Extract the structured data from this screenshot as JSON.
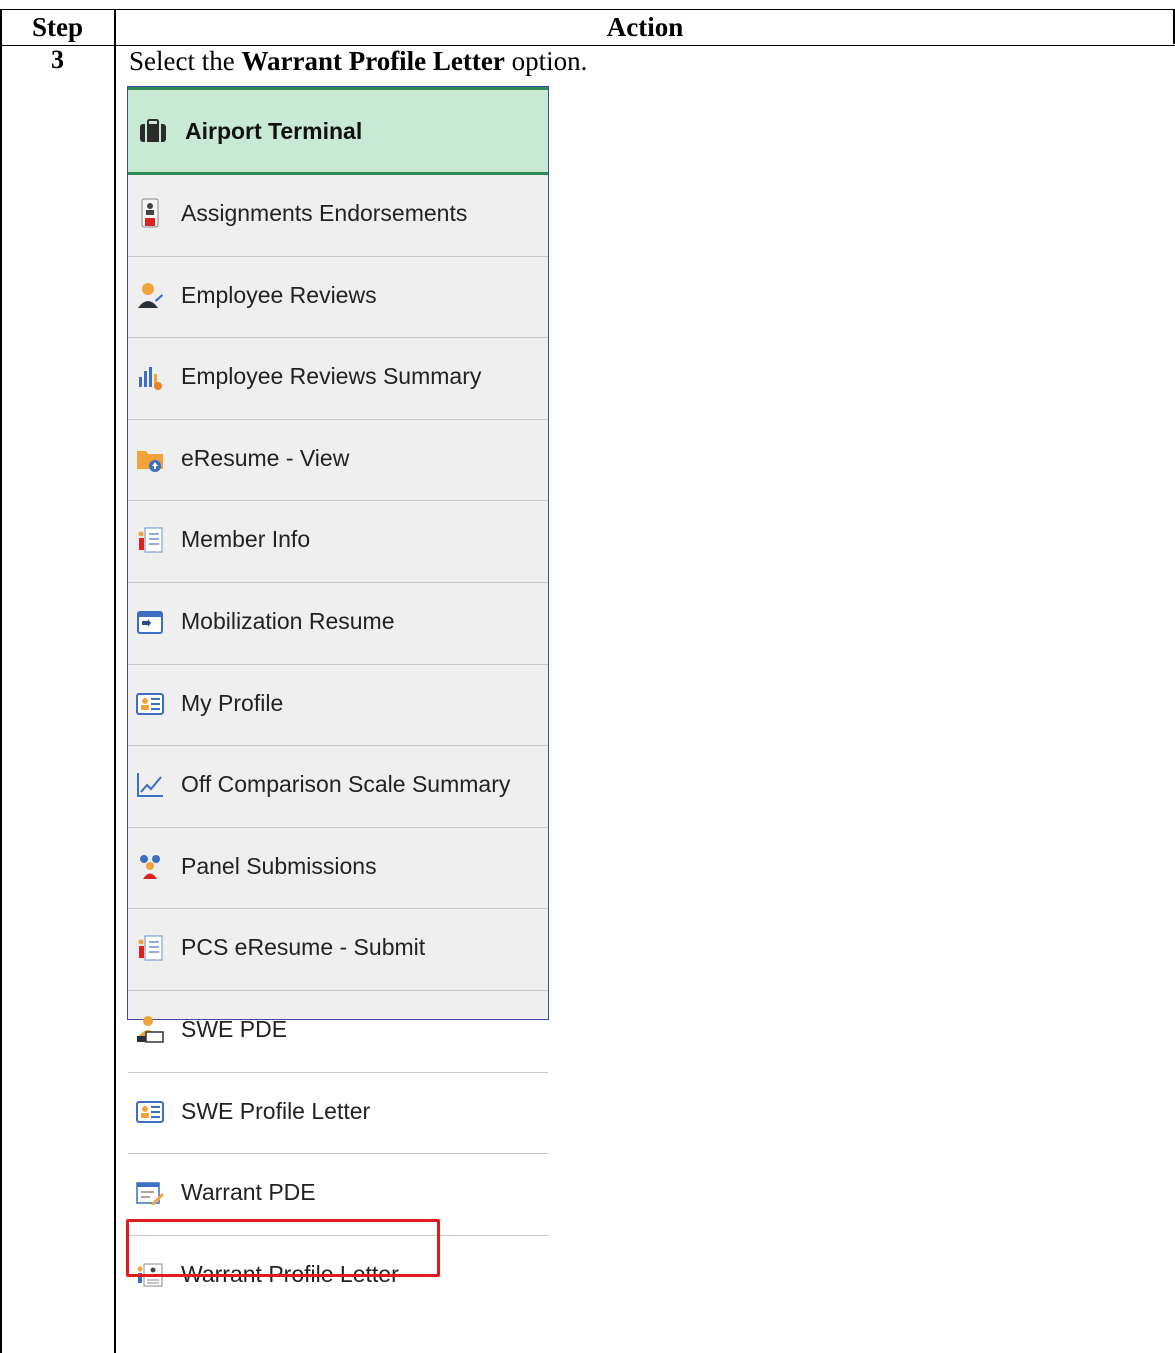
{
  "table": {
    "col_step": "Step",
    "col_action": "Action",
    "step_number": "3",
    "instruction_prefix": "Select the ",
    "instruction_bold": "Warrant Profile Letter",
    "instruction_suffix": " option."
  },
  "menu": {
    "header": {
      "title": "Airport Terminal",
      "icon": "briefcase-icon"
    },
    "items": [
      {
        "label": "Assignments Endorsements",
        "icon": "assignment-badge-icon"
      },
      {
        "label": "Employee Reviews",
        "icon": "person-review-icon"
      },
      {
        "label": "Employee Reviews Summary",
        "icon": "bar-chart-icon"
      },
      {
        "label": "eResume - View",
        "icon": "folder-upload-icon"
      },
      {
        "label": "Member Info",
        "icon": "member-list-icon"
      },
      {
        "label": "Mobilization Resume",
        "icon": "calendar-arrows-icon"
      },
      {
        "label": "My Profile",
        "icon": "profile-card-icon"
      },
      {
        "label": "Off Comparison Scale Summary",
        "icon": "line-chart-icon"
      },
      {
        "label": "Panel Submissions",
        "icon": "panel-people-icon"
      },
      {
        "label": "PCS eResume - Submit",
        "icon": "member-list-icon"
      },
      {
        "label": "SWE PDE",
        "icon": "person-computer-icon"
      },
      {
        "label": "SWE Profile Letter",
        "icon": "profile-card-icon"
      },
      {
        "label": "Warrant PDE",
        "icon": "form-edit-icon"
      },
      {
        "label": "Warrant Profile Letter",
        "icon": "profile-letter-icon"
      }
    ],
    "highlighted_item": "Warrant Profile Letter",
    "highlight_color": "#e21b1b"
  }
}
